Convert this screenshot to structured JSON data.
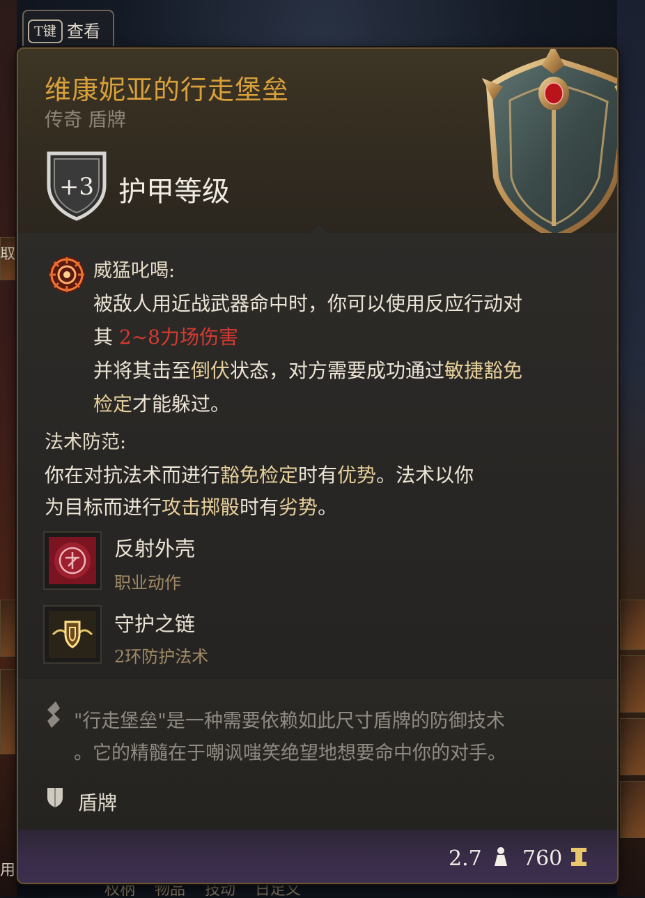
{
  "hotkey": {
    "key": "T键",
    "label": "查看"
  },
  "background": {
    "left_cut_text": "取",
    "left_bottom_text": "用",
    "bottom_text": "权柄    物品    技动    日足义"
  },
  "item": {
    "name": "维康妮亚的行走堡垒",
    "rarity_type": "传奇 盾牌",
    "armor_bonus": "+3",
    "armor_label": "护甲等级",
    "name_color": "#d9a13c"
  },
  "passive1": {
    "title": "威猛叱喝:",
    "line1": "被敌人用近战武器命中时，你可以使用反应行动对",
    "line2_prefix": "其 ",
    "damage": "2~8力场伤害",
    "line3_a": "并将其击至",
    "line3_kw1": "倒伏",
    "line3_b": "状态，对方需要成功通过",
    "line3_kw2": "敏捷豁免",
    "line4_kw": "检定",
    "line4_b": "才能躲过。",
    "icon": "roar-burst-icon",
    "damage_color": "#d63a32"
  },
  "passive2": {
    "title": "法术防范:",
    "line1_a": "你在对抗法术而进行",
    "line1_kw": "豁免检定",
    "line1_b": "时有",
    "line1_kw2": "优势",
    "line1_c": "。法术以你",
    "line2_a": "为目标而进行",
    "line2_kw": "攻击掷骰",
    "line2_b": "时有",
    "line2_kw2": "劣势",
    "line2_c": "。"
  },
  "granted": [
    {
      "name": "反射外壳",
      "type": "职业动作",
      "icon": "reflective-shell-icon"
    },
    {
      "name": "守护之链",
      "type": "2环防护法术",
      "icon": "warding-bond-icon"
    }
  ],
  "flavor": {
    "line1": "\"行走堡垒\"是一种需要依赖如此尺寸盾牌的防御技术",
    "line2": "。它的精髓在于嘲讽嗤笑绝望地想要命中你的对手。"
  },
  "category": {
    "label": "盾牌",
    "icon": "shield-category-icon"
  },
  "footer": {
    "weight": "2.7",
    "price": "760",
    "weight_icon": "weight-icon",
    "coin_icon": "gold-coin-icon"
  }
}
